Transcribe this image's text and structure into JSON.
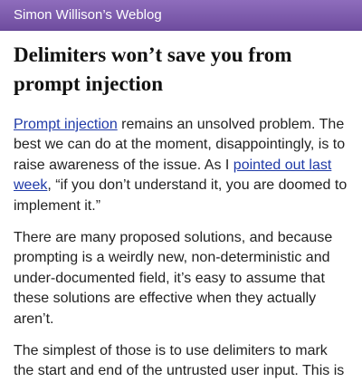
{
  "site": {
    "title": "Simon Willison’s Weblog",
    "header_color": "#7a5aa9"
  },
  "article": {
    "title": "Delimiters won’t save you from prompt injection",
    "paragraph1": {
      "link1": "Prompt injection",
      "text1": " remains an unsolved problem. The best we can do at the moment, disappointingly, is to raise awareness of the issue. As I ",
      "link2": "pointed out last week",
      "text2": ", “if you don’t understand it, you are doomed to implement it.”"
    },
    "paragraph2": "There are many proposed solutions, and because prompting is a weirdly new, non-deterministic and under-documented field, it’s easy to assume that these solutions are effective when they actually aren’t.",
    "paragraph3": "The simplest of those is to use delimiters to mark the start and end of the untrusted user input. This is"
  }
}
